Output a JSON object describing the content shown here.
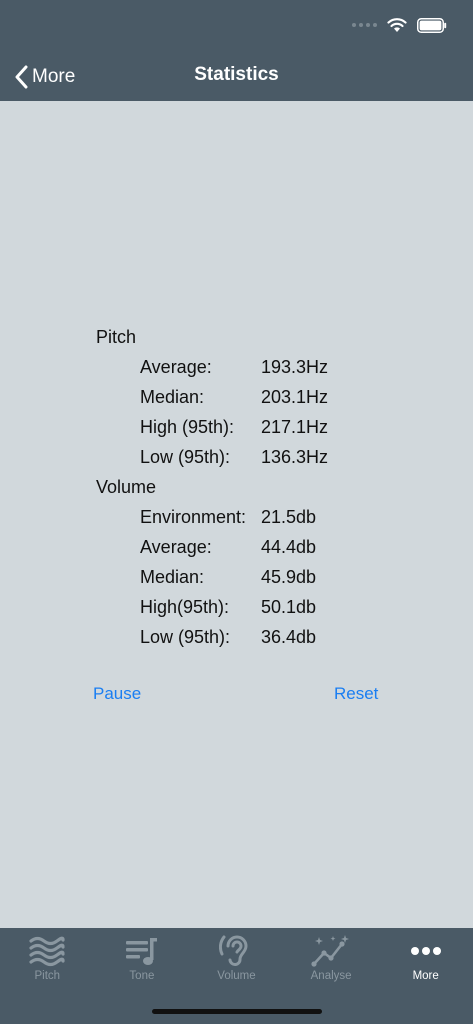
{
  "header": {
    "back_label": "More",
    "title": "Statistics"
  },
  "stats": {
    "pitch": {
      "title": "Pitch",
      "rows": [
        {
          "label": "Average:",
          "value": "193.3Hz"
        },
        {
          "label": "Median:",
          "value": "203.1Hz"
        },
        {
          "label": "High (95th):",
          "value": "217.1Hz"
        },
        {
          "label": "Low (95th):",
          "value": "136.3Hz"
        }
      ]
    },
    "volume": {
      "title": "Volume",
      "rows": [
        {
          "label": "Environment:",
          "value": "21.5db"
        },
        {
          "label": "Average:",
          "value": "44.4db"
        },
        {
          "label": "Median:",
          "value": "45.9db"
        },
        {
          "label": "High(95th):",
          "value": "50.1db"
        },
        {
          "label": "Low (95th):",
          "value": "36.4db"
        }
      ]
    }
  },
  "actions": {
    "pause_label": "Pause",
    "reset_label": "Reset"
  },
  "tabbar": {
    "tabs": [
      {
        "label": "Pitch",
        "icon": "waves-icon"
      },
      {
        "label": "Tone",
        "icon": "music-list-icon"
      },
      {
        "label": "Volume",
        "icon": "ear-icon"
      },
      {
        "label": "Analyse",
        "icon": "sparkle-chart-icon"
      },
      {
        "label": "More",
        "icon": "more-dots-icon"
      }
    ],
    "active": "More"
  },
  "colors": {
    "header_bg": "#4a5a66",
    "content_bg": "#d1d8dc",
    "link": "#1a7ef2",
    "tab_inactive": "#8a97a0",
    "tab_active": "#ffffff"
  }
}
